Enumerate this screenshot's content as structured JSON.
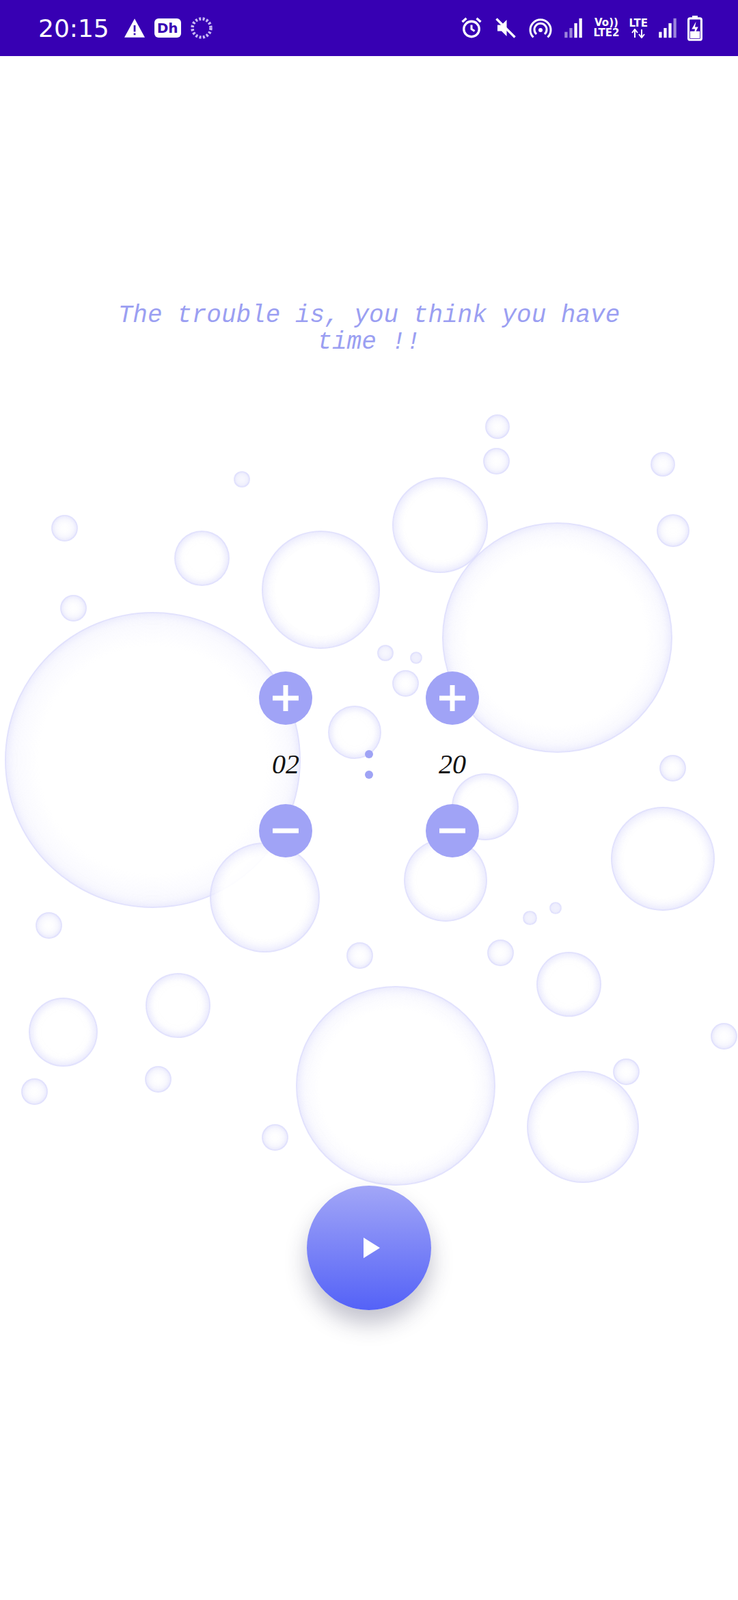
{
  "status_bar": {
    "time": "20:15",
    "dh_badge": "Dh",
    "volte": "Vo))",
    "lte2": "LTE2",
    "lte": "LTE"
  },
  "quote": "The trouble is, you think you have time !!",
  "timer": {
    "minutes": "02",
    "seconds": "20"
  }
}
